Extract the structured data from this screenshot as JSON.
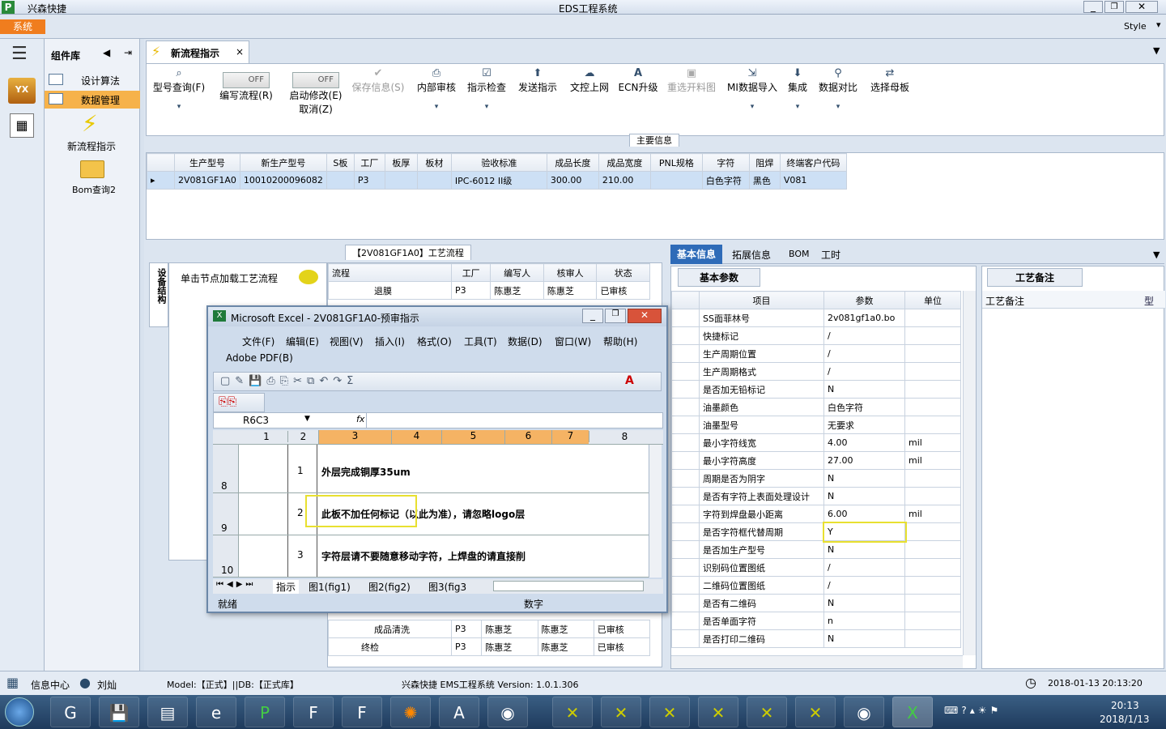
{
  "window": {
    "app_name": "兴森快捷",
    "title": "EDS工程系统",
    "style_label": "Style"
  },
  "menu": {
    "system_tab": "系统"
  },
  "component_panel": {
    "title": "组件库",
    "items": [
      "设计算法",
      "数据管理"
    ],
    "launchers": [
      "新流程指示",
      "Bom查询2"
    ]
  },
  "doc_tab": {
    "label": "新流程指示"
  },
  "ribbon": {
    "buttons": [
      {
        "label": "型号查询(F)",
        "icon": "search-icon",
        "disabled": false
      },
      {
        "label": "编写流程(R)",
        "toggle": "OFF"
      },
      {
        "label": "启动修改(E)",
        "sub": "取消(Z)",
        "toggle": "OFF"
      },
      {
        "label": "保存信息(S)",
        "icon": "check-icon",
        "disabled": true
      },
      {
        "label": "内部审核",
        "icon": "printer-icon",
        "disabled": false
      },
      {
        "label": "指示检查",
        "icon": "checkbox-icon",
        "disabled": false
      },
      {
        "label": "发送指示",
        "icon": "upload-icon",
        "disabled": false
      },
      {
        "label": "文控上网",
        "icon": "cloud-upload-icon",
        "disabled": false
      },
      {
        "label": "ECN升级",
        "icon": "letter-a-icon",
        "disabled": false
      },
      {
        "label": "重选开料图",
        "icon": "image-icon",
        "disabled": true
      },
      {
        "label": "MI数据导入",
        "icon": "import-icon",
        "disabled": false
      },
      {
        "label": "集成",
        "icon": "download-icon",
        "disabled": false
      },
      {
        "label": "数据对比",
        "icon": "compare-icon",
        "disabled": false
      },
      {
        "label": "选择母板",
        "icon": "shuffle-icon",
        "disabled": false
      }
    ],
    "section_label": "主要信息"
  },
  "main_table": {
    "headers": [
      "生产型号",
      "新生产型号",
      "S板",
      "工厂",
      "板厚",
      "板材",
      "验收标准",
      "成品长度",
      "成品宽度",
      "PNL规格",
      "字符",
      "阻焊",
      "终端客户代码"
    ],
    "row": [
      "2V081GF1A0",
      "10010200096082",
      "",
      "P3",
      "",
      "",
      "IPC-6012 II级",
      "300.00",
      "210.00",
      "",
      "白色字符",
      "黑色",
      "V081"
    ]
  },
  "process_panel": {
    "caption": "【2V081GF1A0】工艺流程",
    "side_tab": "设备结构",
    "hint": "单击节点加载工艺流程",
    "headers": [
      "流程",
      "工厂",
      "编写人",
      "核审人",
      "状态"
    ],
    "rows_top": [
      [
        "退膜",
        "P3",
        "陈惠芝",
        "陈惠芝",
        "已审核"
      ]
    ],
    "rows_bottom": [
      [
        "成品清洗",
        "P3",
        "陈惠芝",
        "陈惠芝",
        "已审核"
      ],
      [
        "终检",
        "P3",
        "陈惠芝",
        "陈惠芝",
        "已审核"
      ]
    ]
  },
  "right_tabs": [
    "基本信息",
    "拓展信息",
    "BOM",
    "工时"
  ],
  "basic_params": {
    "tab": "基本参数",
    "headers": [
      "项目",
      "参数",
      "单位"
    ],
    "rows": [
      [
        "SS面菲林号",
        "2v081gf1a0.bo",
        ""
      ],
      [
        "快捷标记",
        "/",
        ""
      ],
      [
        "生产周期位置",
        "/",
        ""
      ],
      [
        "生产周期格式",
        "/",
        ""
      ],
      [
        "是否加无铅标记",
        "N",
        ""
      ],
      [
        "油墨颜色",
        "白色字符",
        ""
      ],
      [
        "油墨型号",
        "无要求",
        ""
      ],
      [
        "最小字符线宽",
        "4.00",
        "mil"
      ],
      [
        "最小字符高度",
        "27.00",
        "mil"
      ],
      [
        "周期是否为阴字",
        "N",
        ""
      ],
      [
        "是否有字符上表面处理设计",
        "N",
        ""
      ],
      [
        "字符到焊盘最小距离",
        "6.00",
        "mil"
      ],
      [
        "是否字符框代替周期",
        "Y",
        ""
      ],
      [
        "是否加生产型号",
        "N",
        ""
      ],
      [
        "识别码位置图纸",
        "/",
        ""
      ],
      [
        "二维码位置图纸",
        "/",
        ""
      ],
      [
        "是否有二维码",
        "N",
        ""
      ],
      [
        "是否单面字符",
        "n",
        ""
      ],
      [
        "是否打印二维码",
        "N",
        ""
      ]
    ]
  },
  "remarks": {
    "tab": "工艺备注",
    "header": "工艺备注",
    "col": "型"
  },
  "excel": {
    "title": "Microsoft Excel - 2V081GF1A0-预审指示",
    "menus": [
      "文件(F)",
      "编辑(E)",
      "视图(V)",
      "插入(I)",
      "格式(O)",
      "工具(T)",
      "数据(D)",
      "窗口(W)",
      "帮助(H)"
    ],
    "menu2": "Adobe PDF(B)",
    "namebox": "R6C3",
    "fx": "fx",
    "col_headers": [
      "1",
      "2",
      "3",
      "4",
      "5",
      "6",
      "7",
      "8"
    ],
    "rows": [
      {
        "rownum": "8",
        "no": "1",
        "text": "外层完成铜厚35um"
      },
      {
        "rownum": "9",
        "no": "2",
        "text": "此板不加任何标记（以此为准），请忽略logo层"
      },
      {
        "rownum": "10",
        "no": "3",
        "text": "字符层请不要随意移动字符，上焊盘的请直接削"
      }
    ],
    "sheets": [
      "指示",
      "图1(fig1)",
      "图2(fig2)",
      "图3(fig3"
    ],
    "status_ready": "就绪",
    "status_num": "数字"
  },
  "statusbar": {
    "info_center": "信息中心",
    "user": "刘灿",
    "model": "Model:【正式】||DB:【正式库】",
    "version": "兴森快捷 EMS工程系统 Version: 1.0.1.306",
    "datetime": "2018-01-13 20:13:20"
  },
  "taskbar": {
    "time": "20:13",
    "date": "2018/1/13"
  }
}
